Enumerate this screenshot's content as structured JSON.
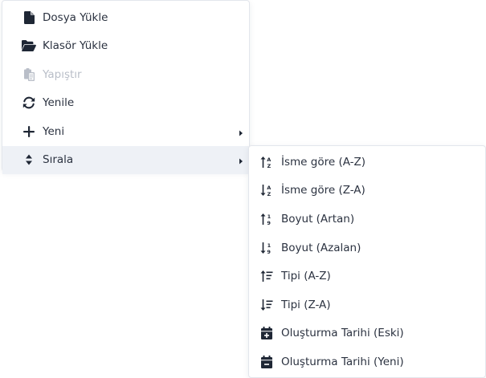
{
  "main_menu": {
    "items": [
      {
        "label": "Dosya Yükle",
        "icon": "file-icon",
        "state": "normal"
      },
      {
        "label": "Klasör Yükle",
        "icon": "folder-open-icon",
        "state": "normal"
      },
      {
        "label": "Yapıştır",
        "icon": "paste-icon",
        "state": "disabled"
      },
      {
        "label": "Yenile",
        "icon": "refresh-icon",
        "state": "normal"
      },
      {
        "label": "Yeni",
        "icon": "plus-icon",
        "state": "normal",
        "submenu": true
      },
      {
        "label": "Sırala",
        "icon": "sort-icon",
        "state": "active",
        "submenu": true
      }
    ]
  },
  "sort_submenu": {
    "items": [
      {
        "label": "İsme göre (A-Z)",
        "icon": "sort-alpha-asc-icon"
      },
      {
        "label": "İsme göre (Z-A)",
        "icon": "sort-alpha-desc-icon"
      },
      {
        "label": "Boyut (Artan)",
        "icon": "sort-numeric-asc-icon"
      },
      {
        "label": "Boyut (Azalan)",
        "icon": "sort-numeric-desc-icon"
      },
      {
        "label": "Tipi (A-Z)",
        "icon": "sort-type-asc-icon"
      },
      {
        "label": "Tipi (Z-A)",
        "icon": "sort-type-desc-icon"
      },
      {
        "label": "Oluşturma Tarihi (Eski)",
        "icon": "calendar-plus-icon"
      },
      {
        "label": "Oluşturma Tarihi (Yeni)",
        "icon": "calendar-minus-icon"
      }
    ]
  },
  "colors": {
    "text": "#2b3240",
    "icon": "#1f2735",
    "disabled": "#b9bec8",
    "active_bg": "#eef1f6",
    "border": "#e3e6ec"
  }
}
